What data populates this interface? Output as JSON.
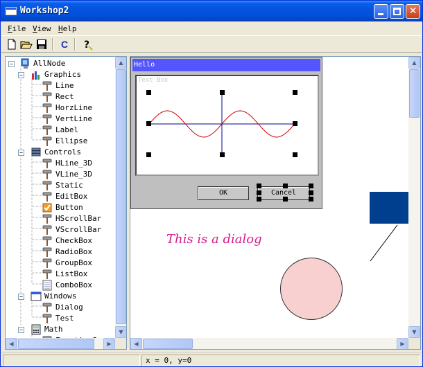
{
  "window": {
    "title": "Workshop2"
  },
  "menu": {
    "file_u": "F",
    "file_rest": "ile",
    "view_u": "V",
    "view_rest": "iew",
    "help_u": "H",
    "help_rest": "elp"
  },
  "toolbar": {
    "c_label": "C",
    "icons": [
      "new-file-icon",
      "open-folder-icon",
      "save-disk-icon",
      "c-icon",
      "help-icon"
    ]
  },
  "tree": {
    "items": [
      {
        "label": "AllNode",
        "icon": "computer-icon"
      },
      {
        "label": "Graphics",
        "icon": "bar-chart-icon"
      },
      {
        "label": "Line",
        "icon": "hammer-icon"
      },
      {
        "label": "Rect",
        "icon": "hammer-icon"
      },
      {
        "label": "HorzLine",
        "icon": "hammer-icon"
      },
      {
        "label": "VertLine",
        "icon": "hammer-icon"
      },
      {
        "label": "Label",
        "icon": "hammer-icon"
      },
      {
        "label": "Ellipse",
        "icon": "hammer-icon"
      },
      {
        "label": "Controls",
        "icon": "stack-icon"
      },
      {
        "label": "HLine_3D",
        "icon": "hammer-icon"
      },
      {
        "label": "VLine_3D",
        "icon": "hammer-icon"
      },
      {
        "label": "Static",
        "icon": "hammer-icon"
      },
      {
        "label": "EditBox",
        "icon": "hammer-icon"
      },
      {
        "label": "Button",
        "icon": "checkbox-icon"
      },
      {
        "label": "HScrollBar",
        "icon": "hammer-icon"
      },
      {
        "label": "VScrollBar",
        "icon": "hammer-icon"
      },
      {
        "label": "CheckBox",
        "icon": "hammer-icon"
      },
      {
        "label": "RadioBox",
        "icon": "hammer-icon"
      },
      {
        "label": "GroupBox",
        "icon": "hammer-icon"
      },
      {
        "label": "ListBox",
        "icon": "hammer-icon"
      },
      {
        "label": "ComboBox",
        "icon": "list-icon"
      },
      {
        "label": "Windows",
        "icon": "window-icon"
      },
      {
        "label": "Dialog",
        "icon": "hammer-icon"
      },
      {
        "label": "Test",
        "icon": "hammer-icon"
      },
      {
        "label": "Math",
        "icon": "calculator-icon"
      },
      {
        "label": "FunctionG",
        "icon": "hammer-icon"
      }
    ]
  },
  "canvas": {
    "dialog_title": "Hello",
    "textbox_label": "Text Box",
    "ok_label": "OK",
    "cancel_label": "Cancel",
    "caption": "This is a dialog",
    "rect_color": "#003f8e",
    "circle_color": "#f8d0d0",
    "text_color": "#d61d8d"
  },
  "status": {
    "coords": "x = 0, y=0"
  },
  "colors": {
    "titlebar": "#0054e3",
    "dialog_title": "#5555ff",
    "sine_wave": "#cc0000",
    "axes": "#00008b"
  }
}
